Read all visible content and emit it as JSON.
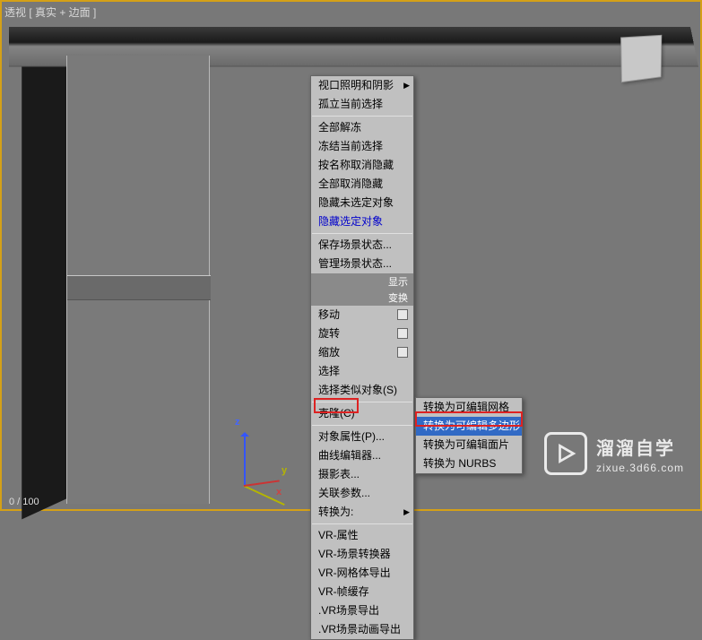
{
  "viewport_label": "透视 [ 真实 + 边面 ]",
  "status": "0 / 100",
  "axis": {
    "x": "x",
    "y": "y",
    "z": "z"
  },
  "menu1": {
    "items": [
      {
        "label": "视口照明和阴影",
        "sub": true
      },
      {
        "label": "孤立当前选择"
      }
    ],
    "sep1": true,
    "items2": [
      {
        "label": "全部解冻"
      },
      {
        "label": "冻结当前选择"
      },
      {
        "label": "按名称取消隐藏"
      },
      {
        "label": "全部取消隐藏"
      },
      {
        "label": "隐藏未选定对象"
      },
      {
        "label": "隐藏选定对象",
        "blue": true
      }
    ],
    "sep2": true,
    "items3": [
      {
        "label": "保存场景状态..."
      },
      {
        "label": "管理场景状态..."
      }
    ],
    "header1": "显示",
    "header2": "变换",
    "items4": [
      {
        "label": "移动",
        "cb": true
      },
      {
        "label": "旋转",
        "cb": true
      },
      {
        "label": "缩放",
        "cb": true
      },
      {
        "label": "选择"
      },
      {
        "label": "选择类似对象(S)"
      }
    ],
    "sep3": true,
    "items5": [
      {
        "label": "克隆(C)"
      }
    ],
    "sep4": true,
    "items6": [
      {
        "label": "对象属性(P)..."
      },
      {
        "label": "曲线编辑器..."
      },
      {
        "label": "摄影表..."
      },
      {
        "label": "关联参数..."
      },
      {
        "label": "转换为:",
        "sub": true,
        "red": true
      }
    ],
    "sep5": true,
    "items7": [
      {
        "label": "VR-属性"
      },
      {
        "label": "VR-场景转换器"
      },
      {
        "label": "VR-网格体导出"
      },
      {
        "label": "VR-帧缓存"
      },
      {
        "label": ".VR场景导出"
      },
      {
        "label": ".VR场景动画导出"
      }
    ]
  },
  "menu2": {
    "items": [
      {
        "label": "转换为可编辑网格"
      },
      {
        "label": "转换为可编辑多边形",
        "hl": true
      },
      {
        "label": "转换为可编辑面片"
      },
      {
        "label": "转换为 NURBS"
      }
    ]
  },
  "watermark": {
    "title": "溜溜自学",
    "url": "zixue.3d66.com"
  }
}
